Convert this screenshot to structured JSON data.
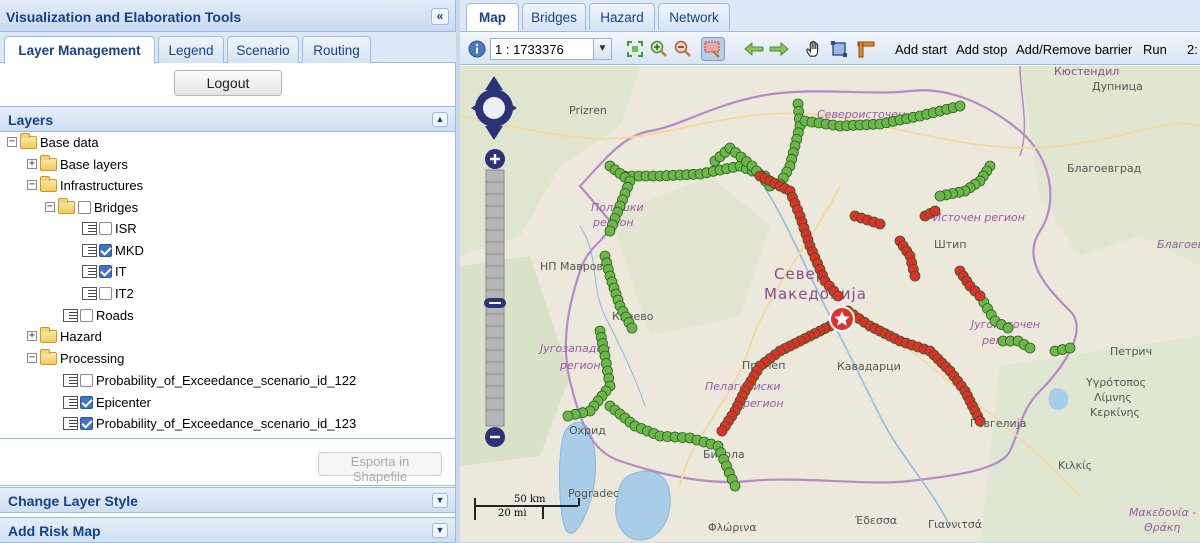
{
  "left_panel": {
    "title": "Visualization and Elaboration Tools",
    "collapse_glyph": "«",
    "tabs": [
      "Layer Management",
      "Legend",
      "Scenario",
      "Routing"
    ],
    "logout_label": "Logout",
    "layers_header": "Layers",
    "tree": {
      "base_data": "Base data",
      "base_layers": "Base layers",
      "infrastructures": "Infrastructures",
      "bridges": "Bridges",
      "isr": "ISR",
      "mkd": "MKD",
      "it": "IT",
      "it2": "IT2",
      "roads": "Roads",
      "hazard": "Hazard",
      "processing": "Processing",
      "poe_122": "Probability_of_Exceedance_scenario_id_122",
      "epicenter": "Epicenter",
      "poe_123": "Probability_of_Exceedance_scenario_id_123"
    },
    "export_label": "Esporta in Shapefile",
    "change_style_header": "Change Layer Style",
    "add_risk_header": "Add Risk Map"
  },
  "right_panel": {
    "tabs": [
      "Map",
      "Bridges",
      "Hazard",
      "Network"
    ],
    "scale_value": "1 : 1733376",
    "actions": [
      "Add start",
      "Add stop",
      "Add/Remove barrier",
      "Run",
      "2:"
    ],
    "map_labels": {
      "kyustendil": "Кюстендил",
      "dupnitsa": "Дупница",
      "prizren": "Prizren",
      "severoistochen": "Североисточен",
      "blagoevgrad": "Благоевград",
      "polosh": "Полошки",
      "polosh_sub": "регион",
      "istochen": "Источен регион",
      "np_mavrovo": "НП Маврово",
      "sever": "Север",
      "makedonija": "Македонија",
      "blagoevgrad_region": "Благоев",
      "jugoistochen": "Југоисточен",
      "jugoistochen_sub": "регион",
      "jugozapaden": "Југозападен",
      "jugozapaden_sub": "регион",
      "kavadarci": "Кавадарци",
      "petrich": "Петрич",
      "pelagoniski": "Пелагониски",
      "pelagoniski_sub": "регион",
      "ohrid": "Охрид",
      "bitola": "Битола",
      "gevgelija": "Гевгелија",
      "yyrostomos": "Υγρότοπος",
      "limnis": "Λίμνης",
      "kerkinis": "Κερκίνης",
      "kilkis": "Κιλκίς",
      "pogradec": "Pogradec",
      "florina": "Φλώρινα",
      "edessa": "Έδεσσα",
      "giannitsa": "Γιαννιτσά",
      "makedonia_thraki": "Μακεδονία -",
      "thraki": "Θράκη",
      "kichevo": "Кичево",
      "tip": "Штип",
      "prilep": "Прилеп"
    },
    "scalebar": {
      "km": "50 km",
      "mi": "20 mi"
    },
    "colors": {
      "green_marker": "#6ab84a",
      "red_marker": "#e0302a",
      "accent": "#15428b"
    }
  }
}
